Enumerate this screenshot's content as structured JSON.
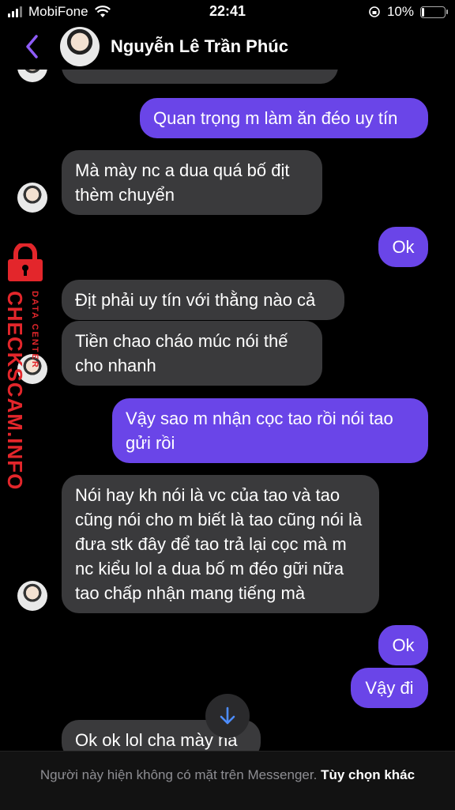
{
  "status_bar": {
    "carrier": "MobiFone",
    "time": "22:41",
    "battery_percent": "10%",
    "battery_level": 0.1
  },
  "header": {
    "contact_name": "Nguyễn Lê Trần Phúc"
  },
  "messages": [
    {
      "direction": "out",
      "text": "Quan trọng m làm ăn đéo uy tín"
    },
    {
      "direction": "in",
      "text": "Mà mày nc a dua quá bố địt thèm chuyển"
    },
    {
      "direction": "out",
      "text": "Ok"
    },
    {
      "direction": "in",
      "text": "Địt phải uy tín với thằng nào cả"
    },
    {
      "direction": "in",
      "text": "Tiền chao cháo múc nói thế cho nhanh"
    },
    {
      "direction": "out",
      "text": "Vậy sao m nhận cọc tao rồi nói tao gửi rồi"
    },
    {
      "direction": "in",
      "text": "Nói hay kh nói là vc của tao và tao cũng nói cho m biết là tao cũng nói là đưa stk đây để tao trả lại cọc mà m nc kiểu lol a dua bố m đéo gữi nữa tao chấp nhận mang tiếng mà"
    },
    {
      "direction": "out",
      "text": "Ok"
    },
    {
      "direction": "out",
      "text": "Vậy đi"
    },
    {
      "direction": "in",
      "text": "Ok ok lol cha mày há"
    }
  ],
  "footer": {
    "notice": "Người này hiện không có mặt trên Messenger.",
    "link": "Tùy chọn khác"
  },
  "watermark": {
    "main": "CHECKSCAM.INFO",
    "sub": "DATA CENTER"
  },
  "icons": {
    "back": "chevron-left-icon",
    "wifi": "wifi-icon",
    "scroll": "arrow-down-icon",
    "lock": "lock-icon"
  },
  "colors": {
    "accent": "#8e5cf7",
    "outgoing": "#6a45e8",
    "incoming": "#3a3a3c",
    "watermark": "#e3262b"
  }
}
